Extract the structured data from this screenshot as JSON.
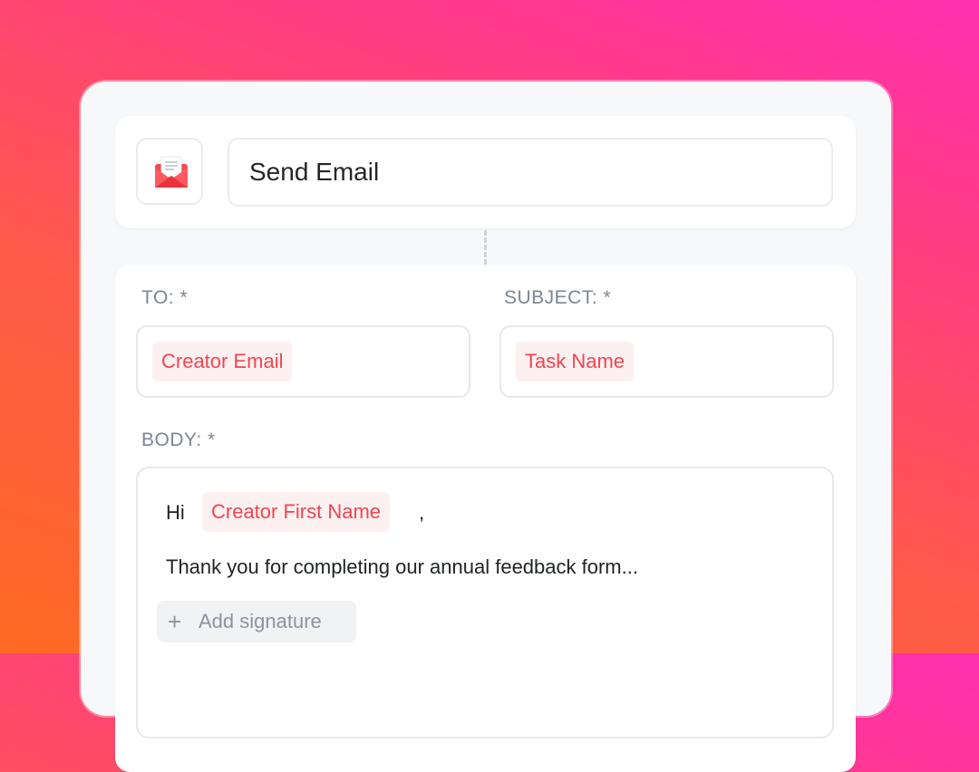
{
  "header": {
    "icon": "envelope-icon",
    "title": "Send Email"
  },
  "form": {
    "to": {
      "label": "TO: *",
      "chip": "Creator Email"
    },
    "subject": {
      "label": "SUBJECT: *",
      "chip": "Task Name"
    },
    "body": {
      "label": "BODY: *",
      "greeting": "Hi",
      "greeting_chip": "Creator First Name",
      "greeting_suffix": ",",
      "text": "Thank you for completing our annual feedback form...",
      "add_signature": "Add signature"
    }
  },
  "colors": {
    "accent_red": "#f04650",
    "chip_bg": "#fdf0f1"
  }
}
